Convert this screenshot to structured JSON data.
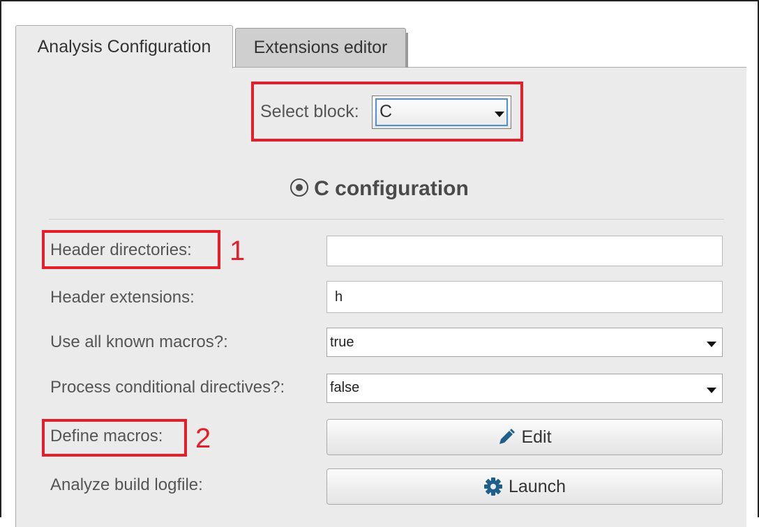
{
  "tabs": [
    {
      "label": "Analysis Configuration",
      "active": true
    },
    {
      "label": "Extensions editor",
      "active": false
    }
  ],
  "select_block": {
    "label": "Select block:",
    "value": "C"
  },
  "section": {
    "title": "C configuration",
    "icon": "target-icon"
  },
  "fields": {
    "header_directories": {
      "label": "Header directories:",
      "value": ""
    },
    "header_extensions": {
      "label": "Header extensions:",
      "value": "h"
    },
    "use_all_known_macros": {
      "label": "Use all known macros?:",
      "value": "true"
    },
    "process_conditional_directives": {
      "label": "Process conditional directives?:",
      "value": "false"
    },
    "define_macros": {
      "label": "Define macros:",
      "button_label": "Edit",
      "icon": "pencil-icon"
    },
    "analyze_build_logfile": {
      "label": "Analyze build logfile:",
      "button_label": "Launch",
      "icon": "gear-icon"
    }
  },
  "annotations": {
    "marker_1": "1",
    "marker_2": "2",
    "color": "#e41f2a"
  },
  "colors": {
    "panel": "#ebebeb",
    "focus": "#4d90d6",
    "icon": "#1f5f8b"
  }
}
